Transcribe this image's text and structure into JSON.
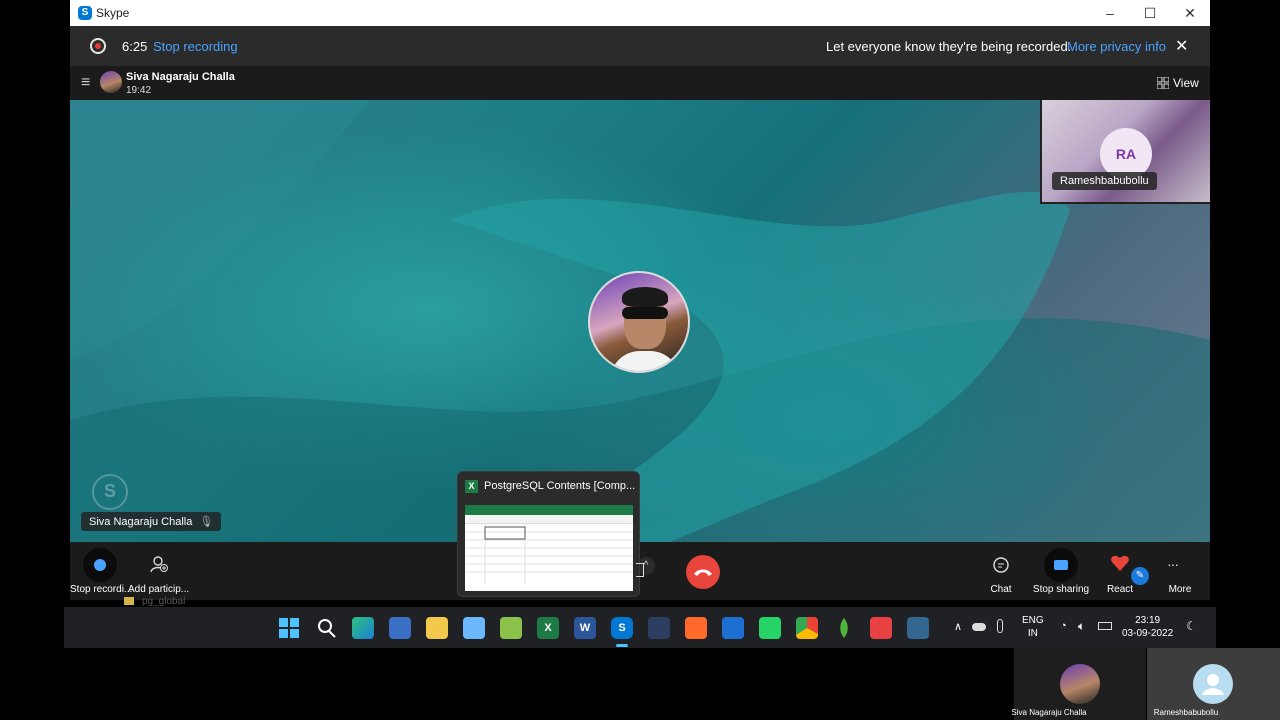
{
  "window": {
    "title": "Skype",
    "minimize_glyph": "–",
    "maximize_glyph": "☐",
    "close_glyph": "✕"
  },
  "recording": {
    "time": "6:25",
    "stop_label": "Stop recording",
    "notice": "Let everyone know they're being recorded.",
    "privacy_link": "More privacy info",
    "close_glyph": "✕",
    "rec_color": "#e23b3b"
  },
  "call_header": {
    "menu_glyph": "≡",
    "caller_name": "Siva Nagaraju Challa",
    "call_time": "19:42",
    "view_label": "View"
  },
  "participant_tile": {
    "initials": "RA",
    "name": "Rameshbabubollu"
  },
  "local_tag": {
    "name": "Siva Nagaraju Challa"
  },
  "preview": {
    "title": "PostgreSQL Contents  [Comp..."
  },
  "controls": {
    "stop_recording_label": "Stop recordi...",
    "add_participants_label": "Add particip...",
    "chat_label": "Chat",
    "stop_sharing_label": "Stop sharing",
    "react_label": "React",
    "more_label": "More",
    "caret_glyph": "^",
    "more_glyph": "···"
  },
  "behind_window_text": "pg_global",
  "taskbar": {
    "language": "ENG",
    "region": "IN",
    "time": "23:19",
    "date": "03-09-2022"
  },
  "bottom_thumbs": [
    {
      "name": "Siva Nagaraju Challa"
    },
    {
      "name": "Rameshbabubollu"
    }
  ],
  "colors": {
    "accent": "#0078d4",
    "link": "#4aa3ff",
    "end_call": "#e8453c"
  }
}
